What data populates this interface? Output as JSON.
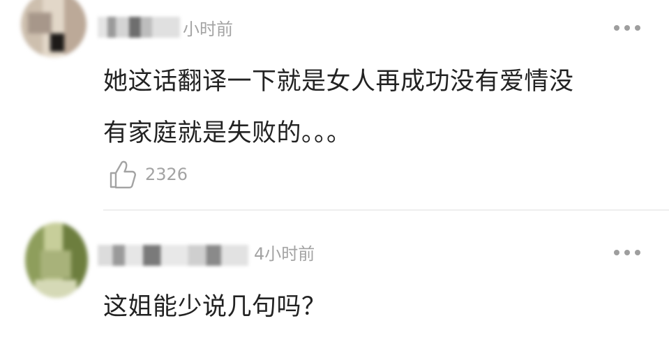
{
  "comments": [
    {
      "time": "小时前",
      "lines": [
        "她这话翻译一下就是女人再成功没有爱情没",
        "有家庭就是失败的。。。"
      ],
      "likes": "2326"
    },
    {
      "time": "4小时前",
      "lines": [
        "这姐能少说几句吗？"
      ]
    }
  ],
  "icons": {
    "like": "thumbs-up-outline-icon",
    "more": "more-dots-icon"
  },
  "colors": {
    "meta_text": "#a3a3a3",
    "body_text": "#222222",
    "divider": "#eeeeee"
  }
}
